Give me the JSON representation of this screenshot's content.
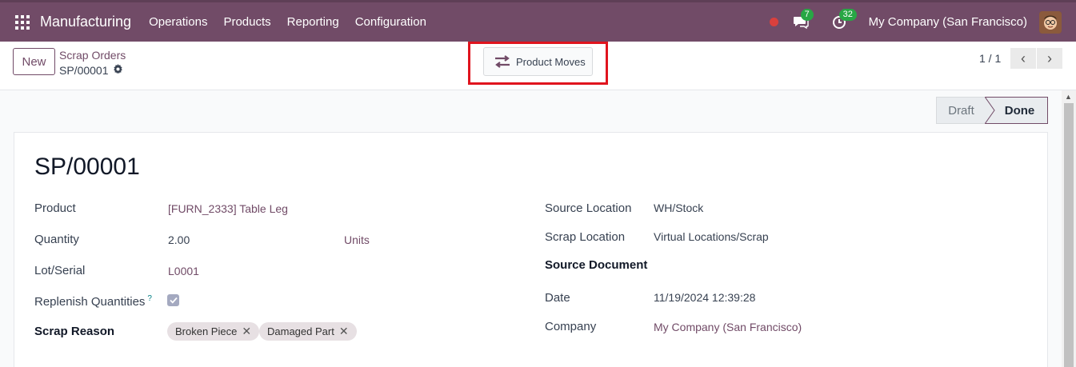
{
  "navbar": {
    "app_name": "Manufacturing",
    "menu": [
      "Operations",
      "Products",
      "Reporting",
      "Configuration"
    ],
    "messages_count": "7",
    "activities_count": "32",
    "company": "My Company (San Francisco)",
    "bg_color": "#714b67"
  },
  "control": {
    "new_label": "New",
    "breadcrumb_parent": "Scrap Orders",
    "breadcrumb_current": "SP/00001",
    "smart_button_label": "Product Moves",
    "pager": "1 / 1"
  },
  "status": {
    "steps": [
      "Draft",
      "Done"
    ],
    "active": "Done"
  },
  "form": {
    "title": "SP/00001",
    "left": {
      "product_label": "Product",
      "product_value": "[FURN_2333] Table Leg",
      "quantity_label": "Quantity",
      "quantity_value": "2.00",
      "uom_value": "Units",
      "lot_label": "Lot/Serial",
      "lot_value": "L0001",
      "replenish_label": "Replenish Quantities",
      "replenish_help": "?",
      "replenish_checked": true,
      "reason_label": "Scrap Reason",
      "reason_tags": [
        "Broken Piece",
        "Damaged Part"
      ]
    },
    "right": {
      "source_location_label": "Source Location",
      "source_location_value": "WH/Stock",
      "scrap_location_label": "Scrap Location",
      "scrap_location_value": "Virtual Locations/Scrap",
      "source_document_label": "Source Document",
      "date_label": "Date",
      "date_value": "11/19/2024 12:39:28",
      "company_label": "Company",
      "company_value": "My Company (San Francisco)"
    }
  },
  "icons": [
    "apps-grid-icon",
    "record-dot-icon",
    "chat-icon",
    "activity-clock-icon",
    "user-avatar",
    "transfer-arrows-icon",
    "gear-icon",
    "chevron-left-icon",
    "chevron-right-icon",
    "check-icon",
    "remove-x-icon"
  ]
}
